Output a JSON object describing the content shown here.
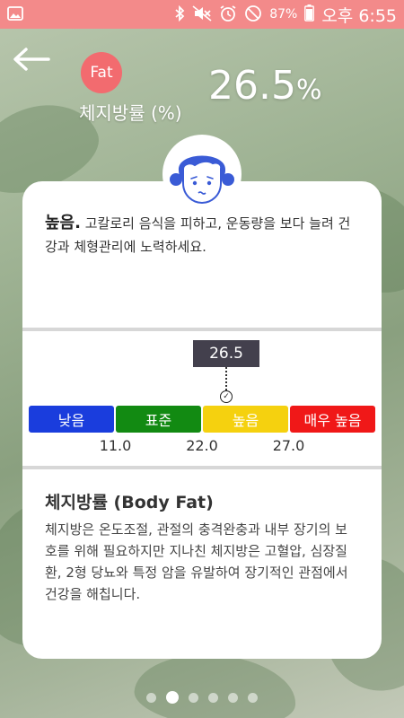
{
  "status_bar": {
    "battery_percent": "87%",
    "time": "오후 6:55",
    "icons": [
      "gallery-icon",
      "bluetooth-icon",
      "mute-icon",
      "alarm-icon",
      "do-not-disturb-icon",
      "battery-icon"
    ]
  },
  "header": {
    "badge": "Fat",
    "metric_label": "체지방률 (%)",
    "value": "26.5",
    "unit": "%"
  },
  "card": {
    "status_strong": "높음.",
    "status_message": " 고칼로리 음식을 피하고, 운동량을 보다 늘려 건강과 체형관리에 노력하세요.",
    "pointer_value": "26.5",
    "pointer_fraction": 0.57,
    "segments": [
      {
        "label": "낮음",
        "color": "#1a3ddd"
      },
      {
        "label": "표준",
        "color": "#128a12"
      },
      {
        "label": "높음",
        "color": "#f5d10f"
      },
      {
        "label": "매우 높음",
        "color": "#f01818"
      }
    ],
    "ticks": [
      "11.0",
      "22.0",
      "27.0"
    ],
    "desc_title": "체지방률 (Body Fat)",
    "desc_body": "체지방은 온도조절, 관절의 충격완충과 내부 장기의 보호를 위해 필요하지만 지나친 체지방은 고혈압, 심장질환, 2형 당뇨와 특정 암을 유발하여 장기적인 관점에서 건강을 해칩니다."
  },
  "pager": {
    "total": 6,
    "active_index": 1
  },
  "colors": {
    "status_bar": "#f38a8a",
    "badge": "#f26b6f",
    "avatar_accent": "#3a5bd6"
  }
}
